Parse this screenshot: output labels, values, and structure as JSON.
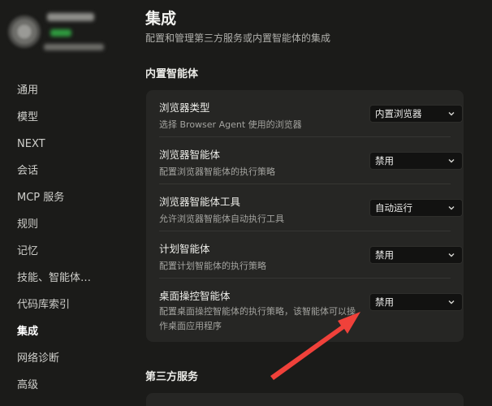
{
  "sidebar": {
    "items": [
      {
        "label": "通用"
      },
      {
        "label": "模型"
      },
      {
        "label": "NEXT"
      },
      {
        "label": "会话"
      },
      {
        "label": "MCP 服务"
      },
      {
        "label": "规则"
      },
      {
        "label": "记忆"
      },
      {
        "label": "技能、智能体…"
      },
      {
        "label": "代码库索引"
      },
      {
        "label": "集成",
        "active": true
      },
      {
        "label": "网络诊断"
      },
      {
        "label": "高级"
      }
    ]
  },
  "main": {
    "title": "集成",
    "subtitle": "配置和管理第三方服务或内置智能体的集成",
    "builtin_section": "内置智能体",
    "third_party_section": "第三方服务",
    "settings": [
      {
        "label": "浏览器类型",
        "desc": "选择 Browser Agent 使用的浏览器",
        "value": "内置浏览器"
      },
      {
        "label": "浏览器智能体",
        "desc": "配置浏览器智能体的执行策略",
        "value": "禁用"
      },
      {
        "label": "浏览器智能体工具",
        "desc": "允许浏览器智能体自动执行工具",
        "value": "自动运行"
      },
      {
        "label": "计划智能体",
        "desc": "配置计划智能体的执行策略",
        "value": "禁用"
      },
      {
        "label": "桌面操控智能体",
        "desc": "配置桌面操控智能体的执行策略，该智能体可以操作桌面应用程序",
        "value": "禁用"
      }
    ]
  },
  "colors": {
    "background": "#1b1b19",
    "card": "#262624",
    "select_bg": "#121211",
    "annotation_arrow": "#f0413a"
  }
}
